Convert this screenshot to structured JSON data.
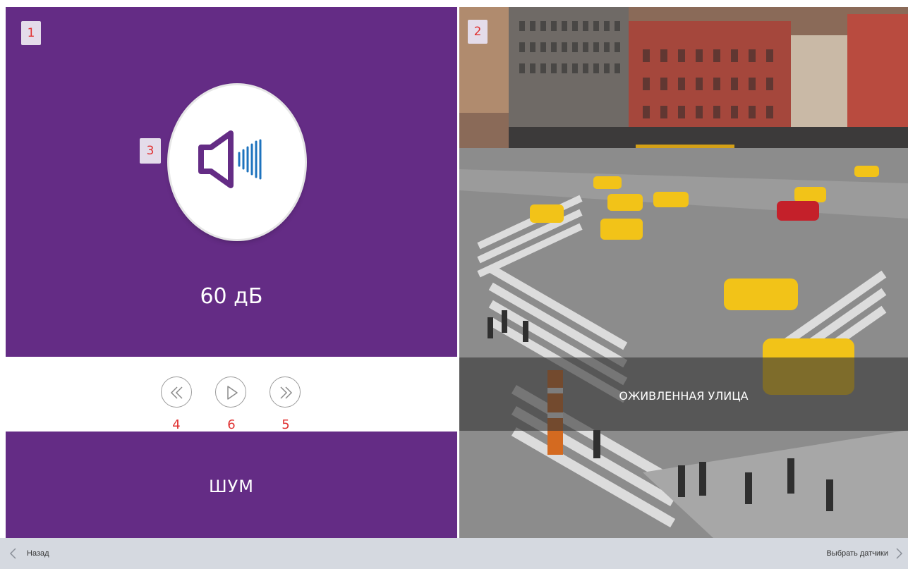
{
  "markers": {
    "m1": "1",
    "m2": "2",
    "m3": "3",
    "m4": "4",
    "m5": "5",
    "m6": "6"
  },
  "sensor": {
    "value": "60 дБ",
    "name": "ШУМ"
  },
  "scene": {
    "caption": "ОЖИВЛЕННАЯ УЛИЦА"
  },
  "footer": {
    "back_label": "Назад",
    "next_label": "Выбрать датчики"
  },
  "colors": {
    "accent": "#642c85",
    "marker_text": "#e03131",
    "icon_blue": "#1e73be",
    "footer_bg": "#d5d9e0"
  },
  "icons": {
    "speaker": "speaker-volume-icon",
    "rewind": "double-chevron-left-icon",
    "play": "play-icon",
    "forward": "double-chevron-right-icon",
    "back": "chevron-left-icon",
    "next": "chevron-right-icon"
  }
}
